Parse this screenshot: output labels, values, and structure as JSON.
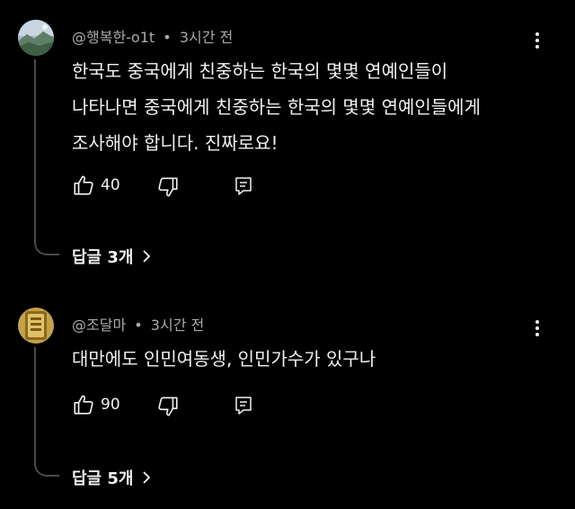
{
  "comments": [
    {
      "handle": "@행복한-o1t",
      "separator": "•",
      "time": "3시간 전",
      "lines": [
        "한국도 중국에게 친중하는 한국의 몇몇 연예인들이",
        "나타나면 중국에게 친중하는 한국의 몇몇 연예인들에게",
        "조사해야 합니다. 진짜로요!"
      ],
      "like_count": "40",
      "replies_label": "답글 3개",
      "avatar_icon": "landscape-avatar"
    },
    {
      "handle": "@조달마",
      "separator": "•",
      "time": "3시간 전",
      "lines": [
        "대만에도 인민여동생, 인민가수가 있구나"
      ],
      "like_count": "90",
      "replies_label": "답글 5개",
      "avatar_icon": "gold-emblem-avatar"
    }
  ],
  "icons": {
    "like": "thumbs-up-icon",
    "dislike": "thumbs-down-icon",
    "reply": "comment-icon",
    "more": "more-vertical-icon",
    "expand": "chevron-right-icon"
  },
  "colors": {
    "background": "#000000",
    "text": "#f1f1f1",
    "meta": "#aaaaaa",
    "thread_line": "#4a4a4a"
  }
}
